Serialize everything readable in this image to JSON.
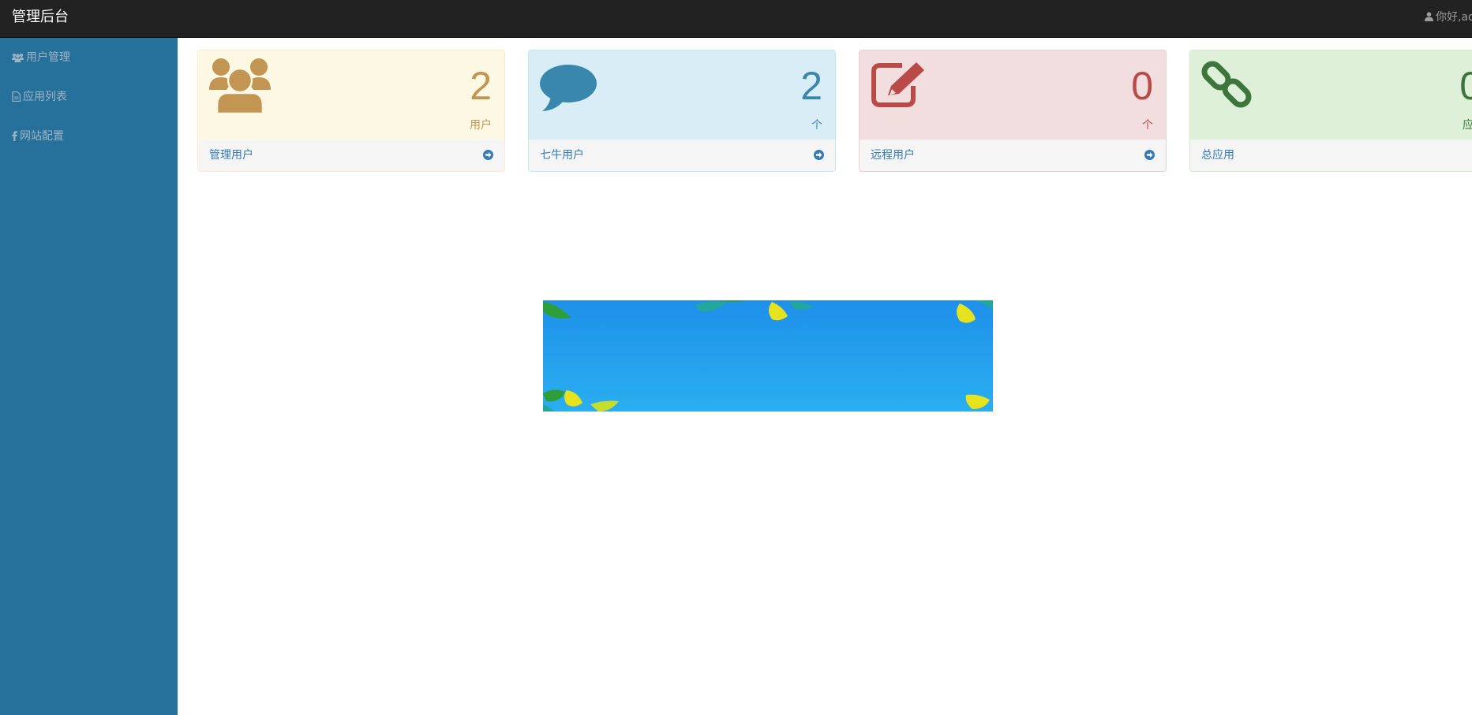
{
  "header": {
    "brand": "管理后台",
    "greeting": "你好,ad"
  },
  "sidebar": {
    "items": [
      {
        "label": "用户管理",
        "icon": "users-icon"
      },
      {
        "label": "应用列表",
        "icon": "file-icon"
      },
      {
        "label": "网站配置",
        "icon": "facebook-icon"
      }
    ]
  },
  "panels": [
    {
      "count": "2",
      "unit": "用户",
      "link": "管理用户",
      "icon": "users-icon",
      "color": "#c29552"
    },
    {
      "count": "2",
      "unit": "个",
      "link": "七牛用户",
      "icon": "comment-icon",
      "color": "#3a87ad"
    },
    {
      "count": "0",
      "unit": "个",
      "link": "远程用户",
      "icon": "edit-icon",
      "color": "#b94a48"
    },
    {
      "count": "0",
      "unit": "应",
      "link": "总应用",
      "icon": "link-icon",
      "color": "#3c763d"
    }
  ],
  "colors": {
    "topbar": "#222222",
    "sidebar": "#26709c",
    "link": "#337ab7"
  }
}
